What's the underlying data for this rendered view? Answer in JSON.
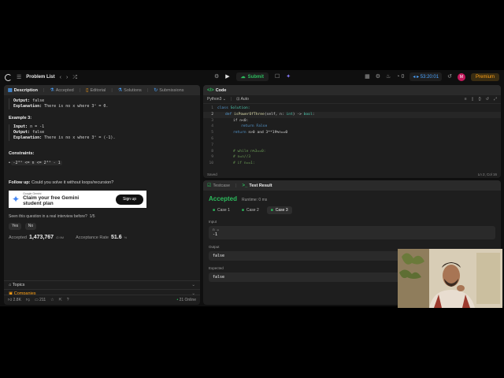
{
  "topbar": {
    "problem_list": "Problem List",
    "submit": "Submit",
    "timer": "53:20:01",
    "streak": "0",
    "avatar_letter": "M",
    "premium": "Premium"
  },
  "left_tabs": [
    "Description",
    "Accepted",
    "Editorial",
    "Solutions",
    "Submissions"
  ],
  "description": {
    "ex2_output_label": "Output:",
    "ex2_output": "false",
    "ex2_expl_label": "Explanation:",
    "ex2_expl": "There is no x where 3ˣ = 0.",
    "ex3_title": "Example 3:",
    "ex3_input_label": "Input:",
    "ex3_input": "n = -1",
    "ex3_output_label": "Output:",
    "ex3_output": "false",
    "ex3_expl_label": "Explanation:",
    "ex3_expl": "There is no x where 3ˣ = (-1).",
    "constraints_title": "Constraints:",
    "constraint": "-2³¹ <= n <= 2³¹ - 1",
    "follow_up_label": "Follow up:",
    "follow_up": "Could you solve it without loops/recursion?"
  },
  "ad": {
    "small": "Google Gemini",
    "line1": "Claim your free Gemini",
    "line2": "student plan",
    "button": "Sign up"
  },
  "interview": {
    "question": "Seen this question in a real interview before?",
    "count": "1/5",
    "yes": "Yes",
    "no": "No"
  },
  "stats": {
    "accepted_label": "Accepted",
    "accepted_value": "1,473,767",
    "accepted_sub": "/2.9M",
    "rate_label": "Acceptance Rate",
    "rate_value": "51.6",
    "rate_unit": "%"
  },
  "sections": {
    "topics": "Topics",
    "companies": "Companies"
  },
  "bottom": {
    "likes": "2.8K",
    "comments": "211",
    "online": "21 Online"
  },
  "code": {
    "title": "Code",
    "language": "Python3",
    "auto": "Auto",
    "status": "Saved",
    "cursor": "Ln 2, Col 16",
    "line_numbers": [
      "1",
      "2",
      "3",
      "4",
      "5",
      "6",
      "7",
      "8",
      "9",
      "10"
    ],
    "lines": {
      "l1a": "class ",
      "l1b": "Solution:",
      "l2a": "def ",
      "l2b": "isPowerOfThree",
      "l2c": "(self, n: ",
      "l2d": "int",
      "l2e": ") -> ",
      "l2f": "bool",
      "l2g": ":",
      "l3": "if n<0:",
      "l4a": "return ",
      "l4b": "False",
      "l5a": "return ",
      "l5b": "n>0 and 3**19%n==0",
      "l8": "# while n%3==0:",
      "l9": "#     n=n//3",
      "l10": "# if n==1:"
    }
  },
  "result": {
    "tab_testcase": "Testcase",
    "tab_result": "Test Result",
    "status": "Accepted",
    "runtime": "Runtime: 0 ms",
    "cases": [
      "Case 1",
      "Case 2",
      "Case 3"
    ],
    "input_label": "Input",
    "input_var": "n =",
    "input_value": "-1",
    "output_label": "Output",
    "output_value": "false",
    "expected_label": "Expected",
    "expected_value": "false"
  },
  "colors": {
    "accent_green": "#2cbb5d",
    "accent_orange": "#ffa116",
    "accent_blue": "#4aa3ff",
    "panel_bg": "#1e1e1e",
    "page_bg": "#0f0f0f"
  }
}
